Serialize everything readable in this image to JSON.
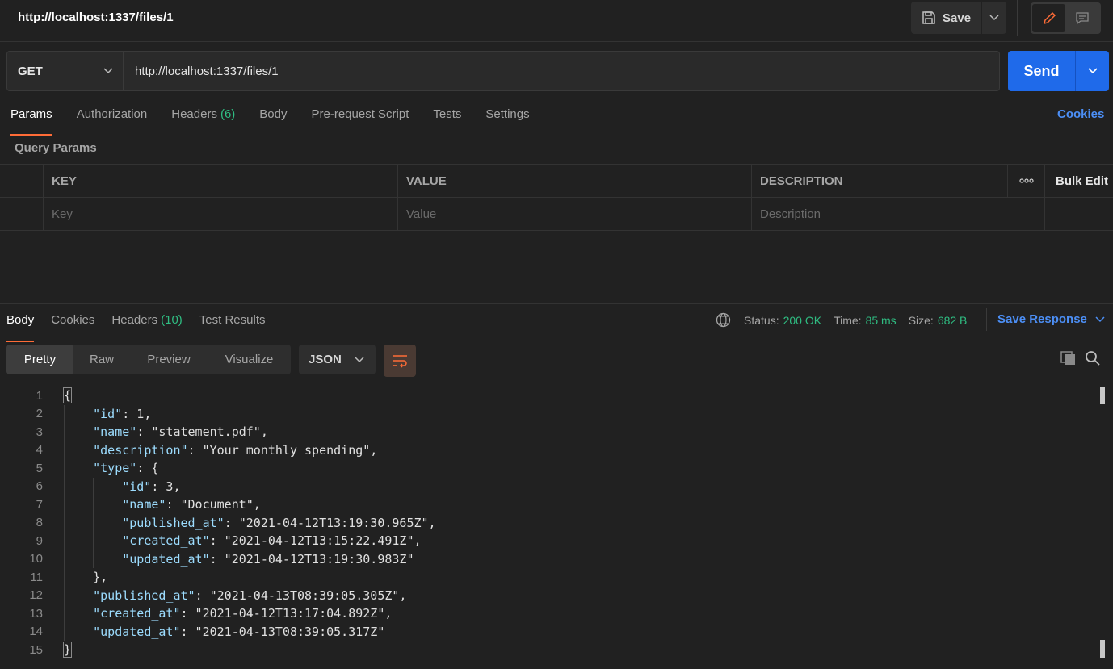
{
  "header": {
    "title": "http://localhost:1337/files/1",
    "save_label": "Save"
  },
  "request": {
    "method": "GET",
    "url": "http://localhost:1337/files/1",
    "send_label": "Send"
  },
  "request_tabs": [
    {
      "label": "Params",
      "active": true
    },
    {
      "label": "Authorization"
    },
    {
      "label": "Headers",
      "count": "(6)"
    },
    {
      "label": "Body"
    },
    {
      "label": "Pre-request Script"
    },
    {
      "label": "Tests"
    },
    {
      "label": "Settings"
    }
  ],
  "cookies_link": "Cookies",
  "query_params": {
    "title": "Query Params",
    "headers": {
      "key": "KEY",
      "value": "VALUE",
      "description": "DESCRIPTION",
      "more": "ooo",
      "bulk_edit": "Bulk Edit"
    },
    "placeholders": {
      "key": "Key",
      "value": "Value",
      "description": "Description"
    }
  },
  "response_tabs": [
    {
      "label": "Body",
      "active": true
    },
    {
      "label": "Cookies"
    },
    {
      "label": "Headers",
      "count": "(10)"
    },
    {
      "label": "Test Results"
    }
  ],
  "response_status": {
    "status_label": "Status:",
    "status": "200 OK",
    "time_label": "Time:",
    "time": "85 ms",
    "size_label": "Size:",
    "size": "682 B",
    "save_response": "Save Response"
  },
  "view_tabs": [
    "Pretty",
    "Raw",
    "Preview",
    "Visualize"
  ],
  "format": "JSON",
  "colors": {
    "accent": "#ff6c37",
    "link": "#4c8ff6",
    "send": "#1f6aea",
    "success": "#2fbd82"
  },
  "code_lines": [
    "{",
    "    \"id\": 1,",
    "    \"name\": \"statement.pdf\",",
    "    \"description\": \"Your monthly spending\",",
    "    \"type\": {",
    "        \"id\": 3,",
    "        \"name\": \"Document\",",
    "        \"published_at\": \"2021-04-12T13:19:30.965Z\",",
    "        \"created_at\": \"2021-04-12T13:15:22.491Z\",",
    "        \"updated_at\": \"2021-04-12T13:19:30.983Z\"",
    "    },",
    "    \"published_at\": \"2021-04-13T08:39:05.305Z\",",
    "    \"created_at\": \"2021-04-12T13:17:04.892Z\",",
    "    \"updated_at\": \"2021-04-13T08:39:05.317Z\"",
    "}"
  ]
}
